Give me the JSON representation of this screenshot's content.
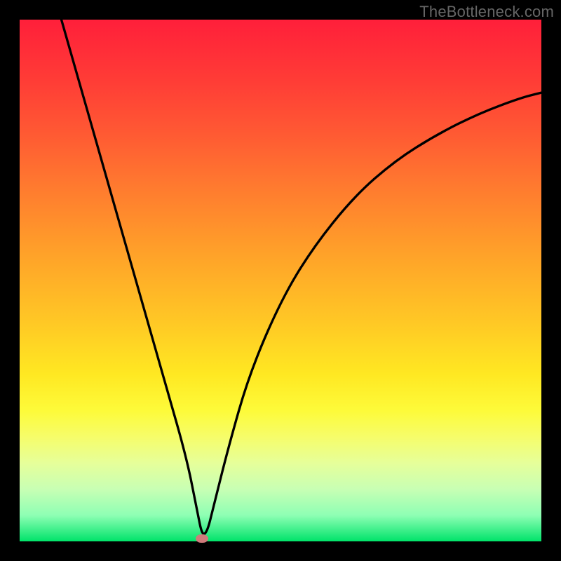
{
  "watermark": "TheBottleneck.com",
  "chart_data": {
    "type": "line",
    "title": "",
    "xlabel": "",
    "ylabel": "",
    "xlim": [
      0,
      100
    ],
    "ylim": [
      0,
      100
    ],
    "grid": false,
    "series": [
      {
        "name": "curve",
        "x": [
          8,
          12,
          16,
          20,
          24,
          28,
          32,
          34,
          35,
          36,
          37,
          40,
          44,
          50,
          56,
          64,
          72,
          80,
          88,
          96,
          100
        ],
        "y": [
          100,
          86,
          72,
          58,
          44,
          30,
          16,
          6,
          1,
          2,
          6,
          18,
          32,
          46,
          56,
          66,
          73,
          78,
          82,
          85,
          86
        ]
      }
    ],
    "marker": {
      "x": 35,
      "y": 0.5,
      "color": "#cf7b7b"
    },
    "background": "rainbow-gradient-vertical"
  }
}
